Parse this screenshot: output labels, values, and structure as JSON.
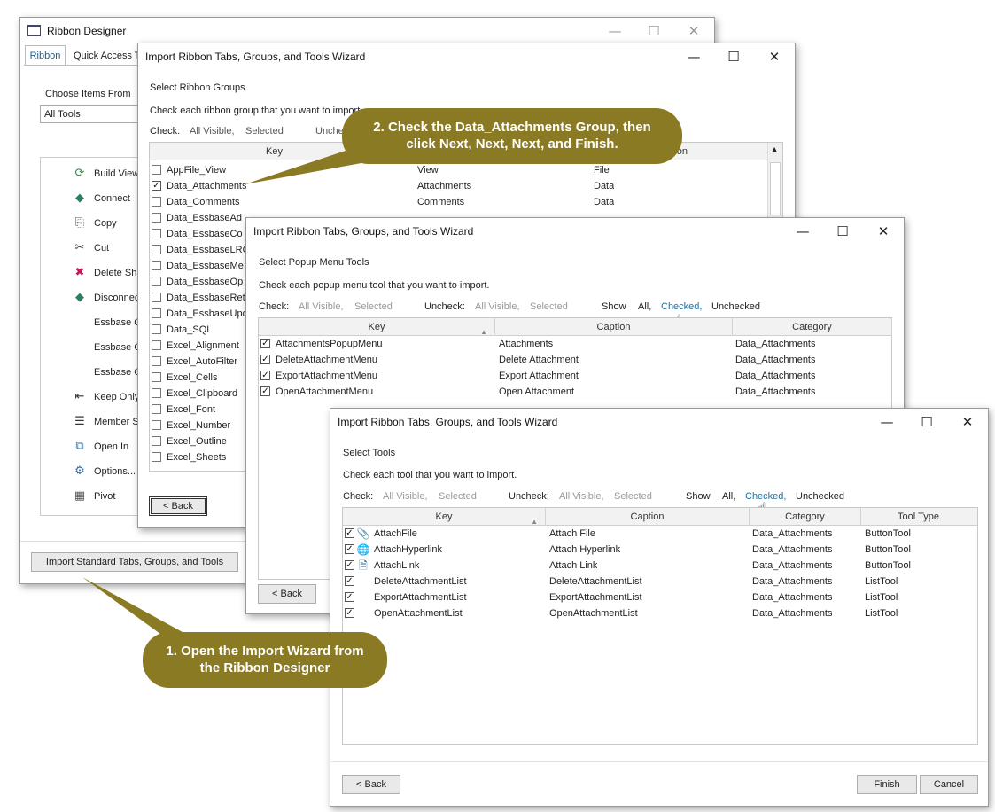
{
  "designer": {
    "title": "Ribbon Designer",
    "tabs": [
      "Ribbon",
      "Quick Access T"
    ],
    "choose_label": "Choose Items From",
    "choose_value": "All Tools",
    "tools": [
      "Build View",
      "Connect",
      "Copy",
      "Cut",
      "Delete Sh",
      "Disconnec",
      "Essbase C",
      "Essbase C",
      "Essbase C",
      "Keep Only",
      "Member S",
      "Open In",
      "Options...",
      "Pivot"
    ],
    "import_button": "Import Standard Tabs, Groups, and Tools"
  },
  "wizard1": {
    "title": "Import Ribbon Tabs, Groups, and Tools Wizard",
    "heading": "Select Ribbon Groups",
    "instruction": "Check each ribbon group that you want to import.",
    "check_label": "Check:",
    "all_visible": "All Visible,",
    "selected": "Selected",
    "uncheck": "Unche",
    "columns": [
      "Key",
      "",
      "aption"
    ],
    "rows": [
      {
        "key": "AppFile_View",
        "group": "View",
        "caption": "File",
        "checked": false
      },
      {
        "key": "Data_Attachments",
        "group": "Attachments",
        "caption": "Data",
        "checked": true
      },
      {
        "key": "Data_Comments",
        "group": "Comments",
        "caption": "Data",
        "checked": false
      },
      {
        "key": "Data_EssbaseAd",
        "checked": false
      },
      {
        "key": "Data_EssbaseCo",
        "checked": false
      },
      {
        "key": "Data_EssbaseLRC",
        "checked": false
      },
      {
        "key": "Data_EssbaseMe",
        "checked": false
      },
      {
        "key": "Data_EssbaseOp",
        "checked": false
      },
      {
        "key": "Data_EssbaseRet",
        "checked": false
      },
      {
        "key": "Data_EssbaseUpd",
        "checked": false
      },
      {
        "key": "Data_SQL",
        "checked": false
      },
      {
        "key": "Excel_Alignment",
        "checked": false
      },
      {
        "key": "Excel_AutoFilter",
        "checked": false
      },
      {
        "key": "Excel_Cells",
        "checked": false
      },
      {
        "key": "Excel_Clipboard",
        "checked": false
      },
      {
        "key": "Excel_Font",
        "checked": false
      },
      {
        "key": "Excel_Number",
        "checked": false
      },
      {
        "key": "Excel_Outline",
        "checked": false
      },
      {
        "key": "Excel_Sheets",
        "checked": false
      }
    ],
    "back": "< Back"
  },
  "wizard2": {
    "title": "Import Ribbon Tabs, Groups, and Tools Wizard",
    "heading": "Select Popup Menu Tools",
    "instruction": "Check each popup menu tool that you want to import.",
    "check_label": "Check:",
    "uncheck_label": "Uncheck:",
    "all_visible": "All Visible,",
    "selected": "Selected",
    "show_label": "Show",
    "show_all": "All,",
    "show_checked": "Checked,",
    "show_unchecked": "Unchecked",
    "columns": [
      "Key",
      "Caption",
      "Category"
    ],
    "rows": [
      {
        "key": "AttachmentsPopupMenu",
        "caption": "Attachments",
        "category": "Data_Attachments"
      },
      {
        "key": "DeleteAttachmentMenu",
        "caption": "Delete Attachment",
        "category": "Data_Attachments"
      },
      {
        "key": "ExportAttachmentMenu",
        "caption": "Export Attachment",
        "category": "Data_Attachments"
      },
      {
        "key": "OpenAttachmentMenu",
        "caption": "Open Attachment",
        "category": "Data_Attachments"
      }
    ],
    "back": "< Back"
  },
  "wizard3": {
    "title": "Import Ribbon Tabs, Groups, and Tools Wizard",
    "heading": "Select Tools",
    "instruction": "Check each tool that you want to import.",
    "check_label": "Check:",
    "uncheck_label": "Uncheck:",
    "all_visible": "All Visible,",
    "selected": "Selected",
    "show_label": "Show",
    "show_all": "All,",
    "show_checked": "Checked,",
    "show_unchecked": "Unchecked",
    "columns": [
      "Key",
      "Caption",
      "Category",
      "Tool Type"
    ],
    "rows": [
      {
        "key": "AttachFile",
        "caption": "Attach File",
        "category": "Data_Attachments",
        "type": "ButtonTool",
        "icon": "paperclip-icon"
      },
      {
        "key": "AttachHyperlink",
        "caption": "Attach Hyperlink",
        "category": "Data_Attachments",
        "type": "ButtonTool",
        "icon": "globe-icon"
      },
      {
        "key": "AttachLink",
        "caption": "Attach Link",
        "category": "Data_Attachments",
        "type": "ButtonTool",
        "icon": "link-file-icon"
      },
      {
        "key": "DeleteAttachmentList",
        "caption": "DeleteAttachmentList",
        "category": "Data_Attachments",
        "type": "ListTool",
        "icon": ""
      },
      {
        "key": "ExportAttachmentList",
        "caption": "ExportAttachmentList",
        "category": "Data_Attachments",
        "type": "ListTool",
        "icon": ""
      },
      {
        "key": "OpenAttachmentList",
        "caption": "OpenAttachmentList",
        "category": "Data_Attachments",
        "type": "ListTool",
        "icon": ""
      }
    ],
    "back": "< Back",
    "finish": "Finish",
    "cancel": "Cancel"
  },
  "callouts": {
    "step1": "1. Open the Import Wizard from the Ribbon Designer",
    "step2": "2. Check the Data_Attachments Group, then click Next, Next, Next, and Finish."
  },
  "colors": {
    "callout": "#8a7a24",
    "link": "#1a73a8"
  }
}
